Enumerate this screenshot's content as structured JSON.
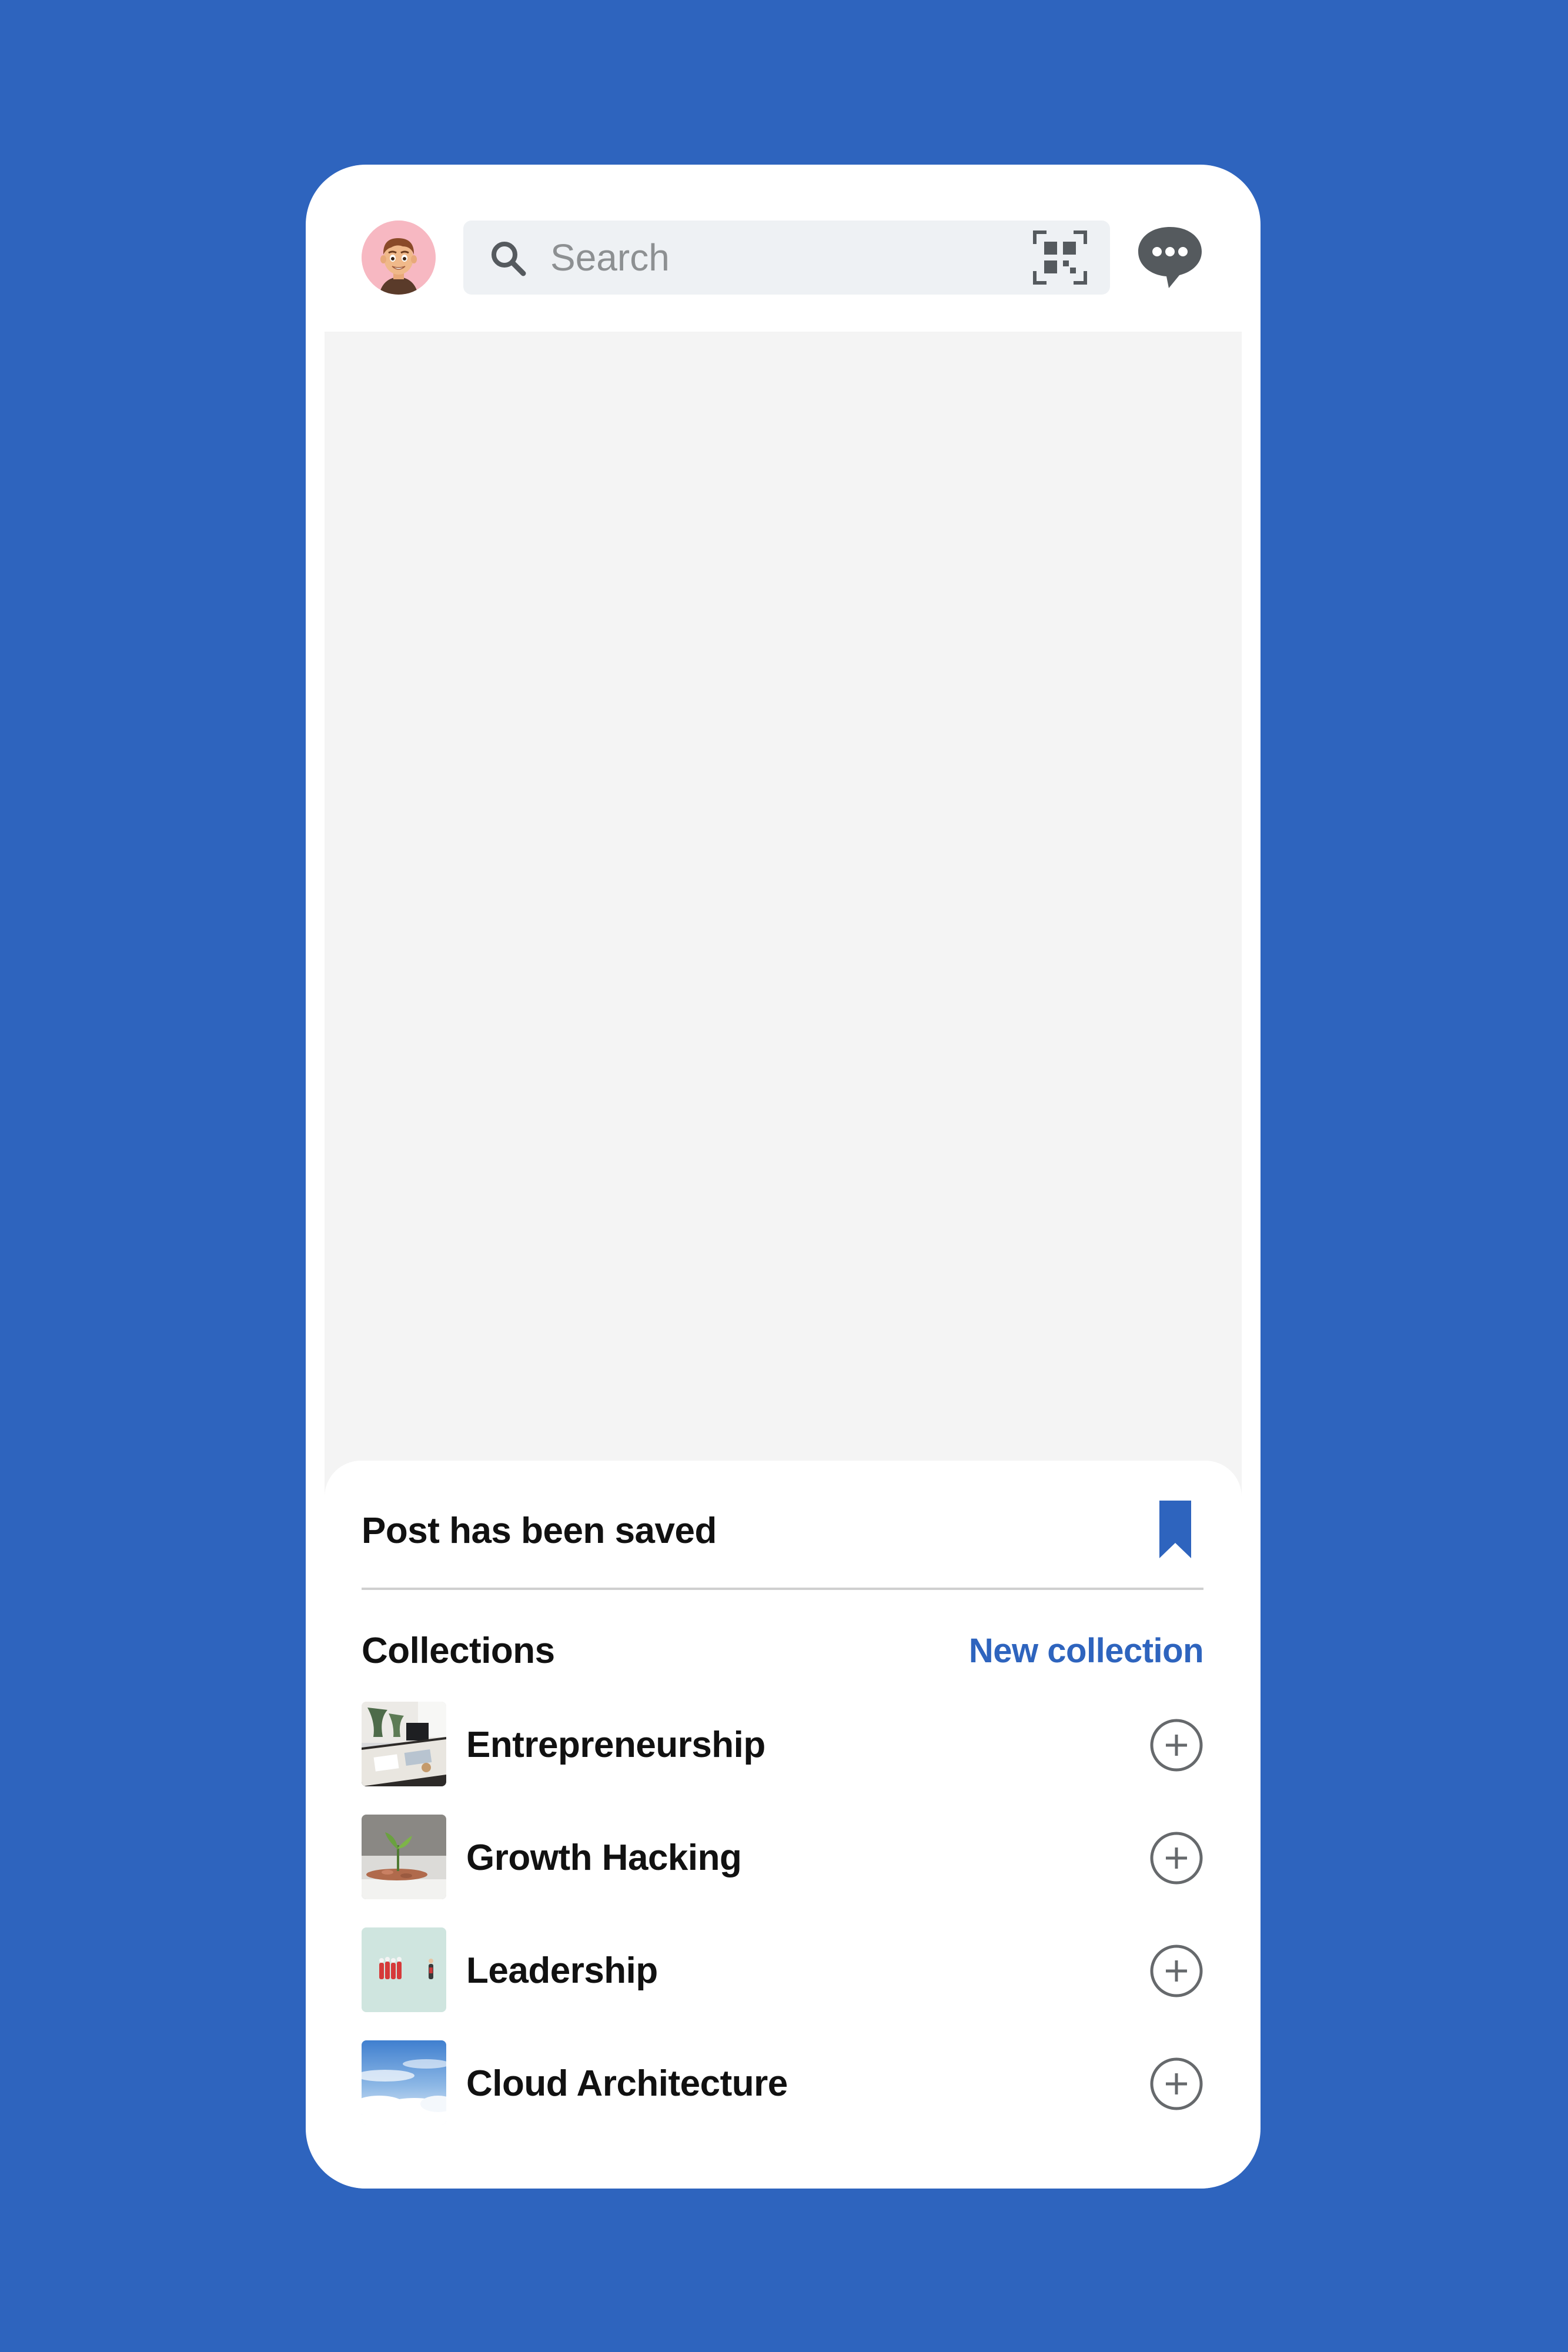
{
  "colors": {
    "background": "#2e64be",
    "accent": "#2e64be",
    "search_bg": "#eef1f4",
    "avatar_bg": "#f7b8c2",
    "feed_placeholder": "#f4f4f4",
    "text": "#111111",
    "icon_gray": "#555a5e"
  },
  "header": {
    "avatar_icon": "memoji-avatar",
    "search": {
      "placeholder": "Search",
      "value": "",
      "left_icon": "search-icon",
      "right_icon": "qr-code-icon"
    },
    "messages_icon": "chat-bubble-icon"
  },
  "sheet": {
    "title": "Post has been saved",
    "title_icon": "bookmark-icon",
    "collections_heading": "Collections",
    "new_collection_label": "New collection",
    "collections": [
      {
        "label": "Entrepreneurship",
        "thumb": "office-desk-photo",
        "action_icon": "add-circle-icon"
      },
      {
        "label": "Growth Hacking",
        "thumb": "plant-coins-photo",
        "action_icon": "add-circle-icon"
      },
      {
        "label": "Leadership",
        "thumb": "figures-photo",
        "action_icon": "add-circle-icon"
      },
      {
        "label": "Cloud Architecture",
        "thumb": "clouds-photo",
        "action_icon": "add-circle-icon"
      }
    ]
  }
}
